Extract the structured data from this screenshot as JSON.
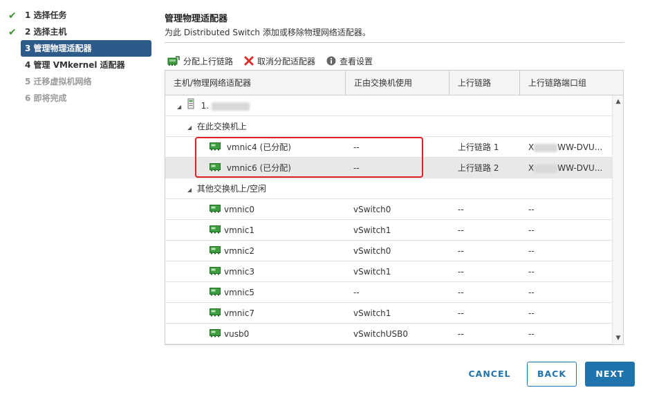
{
  "steps": [
    {
      "label": "1 选择任务",
      "state": "done"
    },
    {
      "label": "2 选择主机",
      "state": "done"
    },
    {
      "label": "3 管理物理适配器",
      "state": "active"
    },
    {
      "label": "4 管理 VMkernel 适配器",
      "state": "normal"
    },
    {
      "label": "5 迁移虚拟机网络",
      "state": "disabled"
    },
    {
      "label": "6 即将完成",
      "state": "disabled"
    }
  ],
  "header": {
    "title": "管理物理适配器",
    "subtitle": "为此 Distributed Switch 添加或移除物理网络适配器。"
  },
  "toolbar": {
    "assign": "分配上行链路",
    "unassign": "取消分配适配器",
    "view": "查看设置"
  },
  "columns": [
    "主机/物理网络适配器",
    "正由交换机使用",
    "上行链路",
    "上行链路端口组"
  ],
  "host": {
    "label": "1."
  },
  "groups": {
    "on_switch": "在此交换机上",
    "other": "其他交换机上/空闲"
  },
  "on_switch_rows": [
    {
      "name": "vmnic4 (已分配)",
      "used_by": "--",
      "uplink": "上行链路 1",
      "portgroup_prefix": "X",
      "portgroup_suffix": "WW-DVU..."
    },
    {
      "name": "vmnic6 (已分配)",
      "used_by": "--",
      "uplink": "上行链路 2",
      "portgroup_prefix": "X",
      "portgroup_suffix": "WW-DVU..."
    }
  ],
  "other_rows": [
    {
      "name": "vmnic0",
      "used_by": "vSwitch0",
      "uplink": "--",
      "portgroup": "--"
    },
    {
      "name": "vmnic1",
      "used_by": "vSwitch1",
      "uplink": "--",
      "portgroup": "--"
    },
    {
      "name": "vmnic2",
      "used_by": "vSwitch0",
      "uplink": "--",
      "portgroup": "--"
    },
    {
      "name": "vmnic3",
      "used_by": "vSwitch1",
      "uplink": "--",
      "portgroup": "--"
    },
    {
      "name": "vmnic5",
      "used_by": "--",
      "uplink": "--",
      "portgroup": "--"
    },
    {
      "name": "vmnic7",
      "used_by": "vSwitch1",
      "uplink": "--",
      "portgroup": "--"
    },
    {
      "name": "vusb0",
      "used_by": "vSwitchUSB0",
      "uplink": "--",
      "portgroup": "--"
    }
  ],
  "buttons": {
    "cancel": "CANCEL",
    "back": "BACK",
    "next": "NEXT"
  },
  "colors": {
    "accent": "#1f74ae",
    "active_step": "#2e5a8a",
    "check": "#3d8f2f",
    "highlight": "#e02020"
  }
}
